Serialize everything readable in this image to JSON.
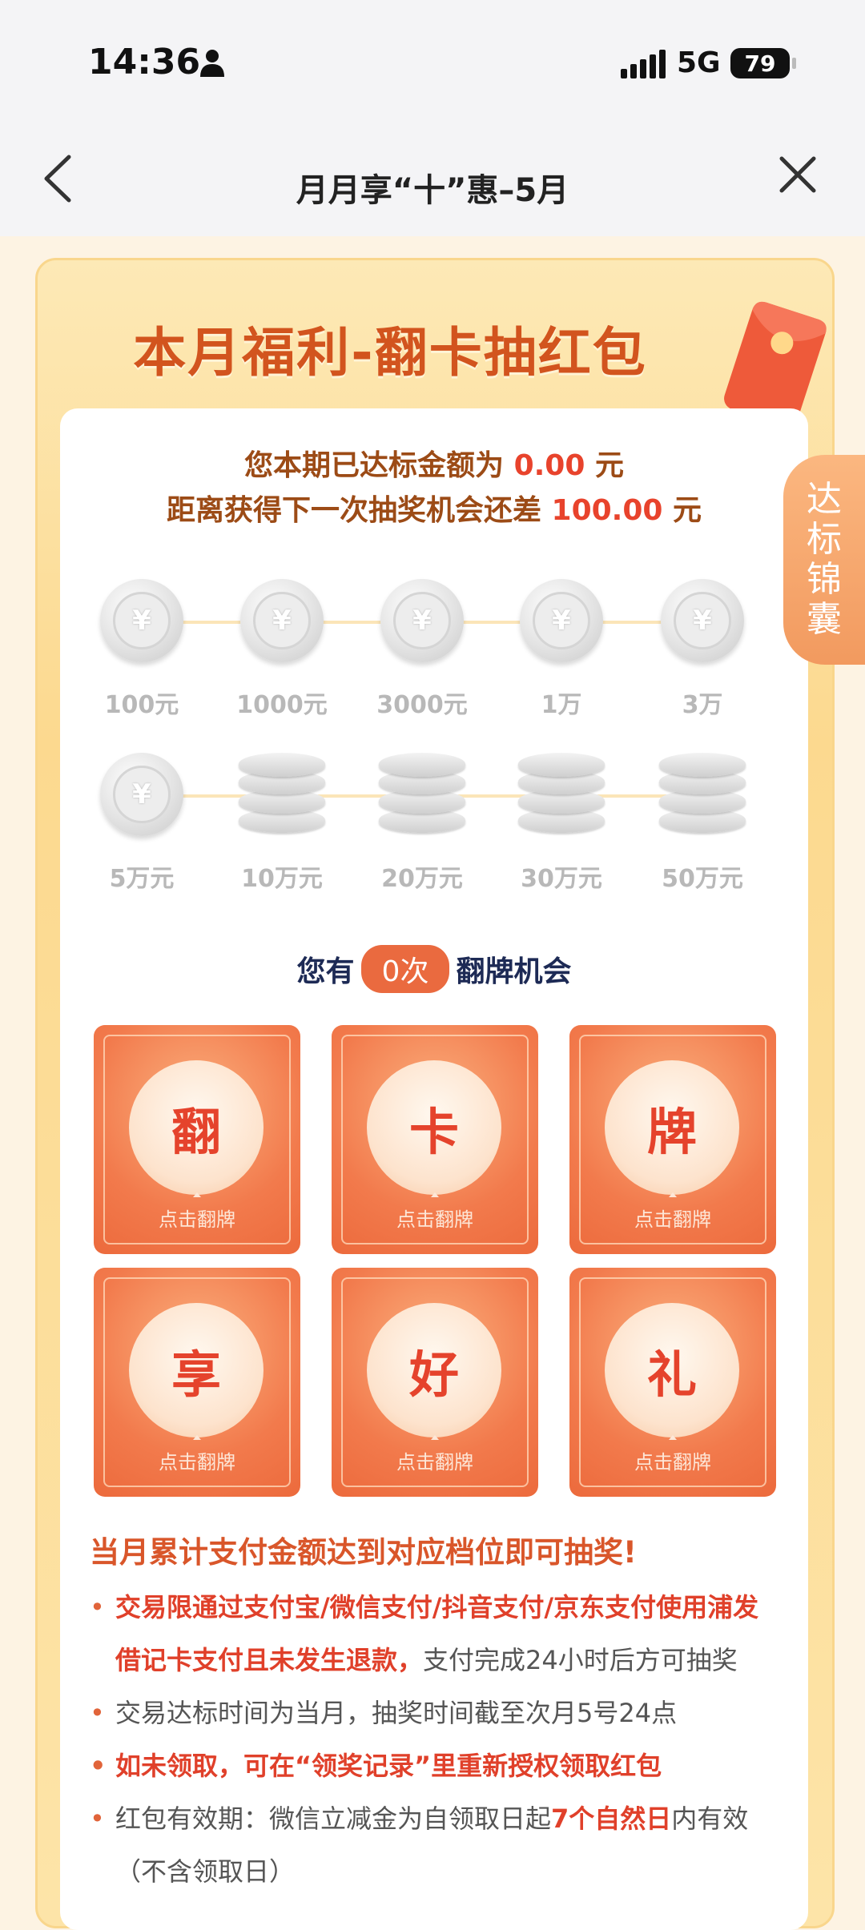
{
  "status_bar": {
    "time": "14:36",
    "network": "5G",
    "battery": "79"
  },
  "nav": {
    "title": "月月享“十”惠–5月"
  },
  "banner": {
    "title": "本月福利-翻卡抽红包"
  },
  "summary": {
    "line1_prefix": "您本期已达标金额为",
    "line1_amount": "0.00",
    "line1_suffix": "元",
    "line2_prefix": "距离获得下一次抽奖机会还差",
    "line2_amount": "100.00",
    "line2_suffix": "元"
  },
  "tiers": [
    {
      "label": "100元",
      "icon": "yuan-coin-icon"
    },
    {
      "label": "1000元",
      "icon": "yuan-coin-icon"
    },
    {
      "label": "3000元",
      "icon": "yuan-coin-icon"
    },
    {
      "label": "1万",
      "icon": "yuan-coin-icon"
    },
    {
      "label": "3万",
      "icon": "yuan-coin-icon"
    },
    {
      "label": "5万元",
      "icon": "yuan-coin-icon"
    },
    {
      "label": "10万元",
      "icon": "coin-stack-icon"
    },
    {
      "label": "20万元",
      "icon": "coin-stack-icon"
    },
    {
      "label": "30万元",
      "icon": "coin-stack-icon"
    },
    {
      "label": "50万元",
      "icon": "coin-stack-icon"
    }
  ],
  "chances": {
    "prefix": "您有",
    "count": "0次",
    "suffix": "翻牌机会"
  },
  "cards": [
    {
      "char": "翻",
      "tip": "点击翻牌"
    },
    {
      "char": "卡",
      "tip": "点击翻牌"
    },
    {
      "char": "牌",
      "tip": "点击翻牌"
    },
    {
      "char": "享",
      "tip": "点击翻牌"
    },
    {
      "char": "好",
      "tip": "点击翻牌"
    },
    {
      "char": "礼",
      "tip": "点击翻牌"
    }
  ],
  "rules": {
    "title": "当月累计支付金额达到对应档位即可抽奖!",
    "r1_em": "交易限通过支付宝/微信支付/抖音支付/京东支付使用浦发借记卡支付且未发生退款，",
    "r1_rest": "支付完成24小时后方可抽奖",
    "r2": "交易达标时间为当月，抽奖时间截至次月5号24点",
    "r3": "如未领取，可在“领奖记录”里重新授权领取红包",
    "r4_a": "红包有效期：微信立减金为自领取日起",
    "r4_b": "7个自然日",
    "r4_c": "内有效（不含领取日）"
  },
  "side_tab": {
    "text": [
      "达",
      "标",
      "锦",
      "囊"
    ]
  },
  "colors": {
    "accent": "#e8432c",
    "card": "#f27a4c",
    "banner": "#fcd98f"
  }
}
